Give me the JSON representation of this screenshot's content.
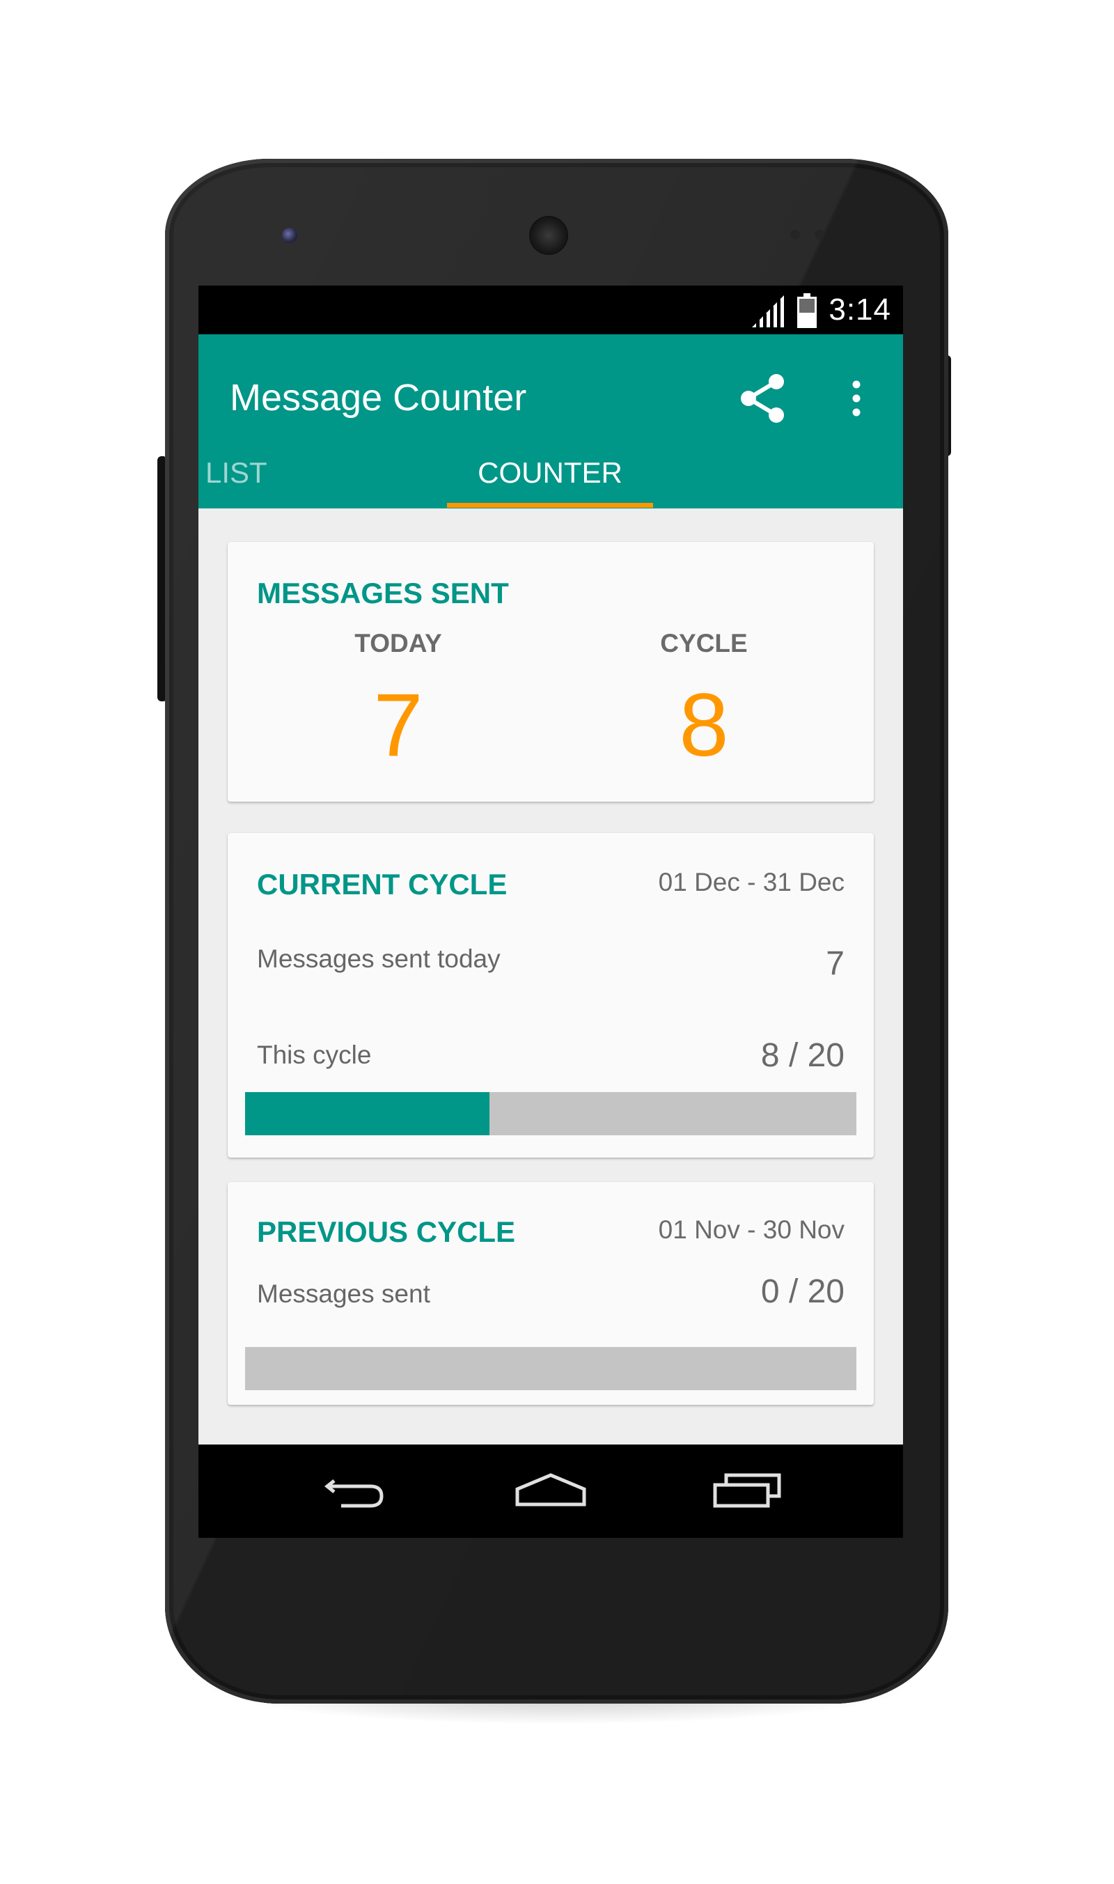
{
  "status_bar": {
    "time": "3:14",
    "signal_icon": "signal-icon",
    "battery_icon": "battery-icon"
  },
  "app_bar": {
    "title": "Message Counter",
    "share_icon": "share-icon",
    "overflow_icon": "more-vert-icon",
    "color": "#009688"
  },
  "tabs": [
    {
      "label": "LIST",
      "selected": false
    },
    {
      "label": "COUNTER",
      "selected": true
    }
  ],
  "accent_color": "#ff9800",
  "messages_sent_card": {
    "title": "MESSAGES SENT",
    "today_label": "TODAY",
    "today_value": "7",
    "cycle_label": "CYCLE",
    "cycle_value": "8"
  },
  "current_cycle_card": {
    "title": "CURRENT CYCLE",
    "date_range": "01 Dec - 31 Dec",
    "today_label": "Messages sent today",
    "today_value": "7",
    "cycle_label": "This cycle",
    "cycle_value": "8 / 20",
    "progress": 0.4
  },
  "previous_cycle_card": {
    "title": "PREVIOUS CYCLE",
    "date_range": "01 Nov - 30 Nov",
    "sent_label": "Messages sent",
    "sent_value": "0 / 20",
    "progress": 0.0
  },
  "nav_bar": {
    "back_icon": "back-icon",
    "home_icon": "home-icon",
    "recents_icon": "recents-icon"
  }
}
